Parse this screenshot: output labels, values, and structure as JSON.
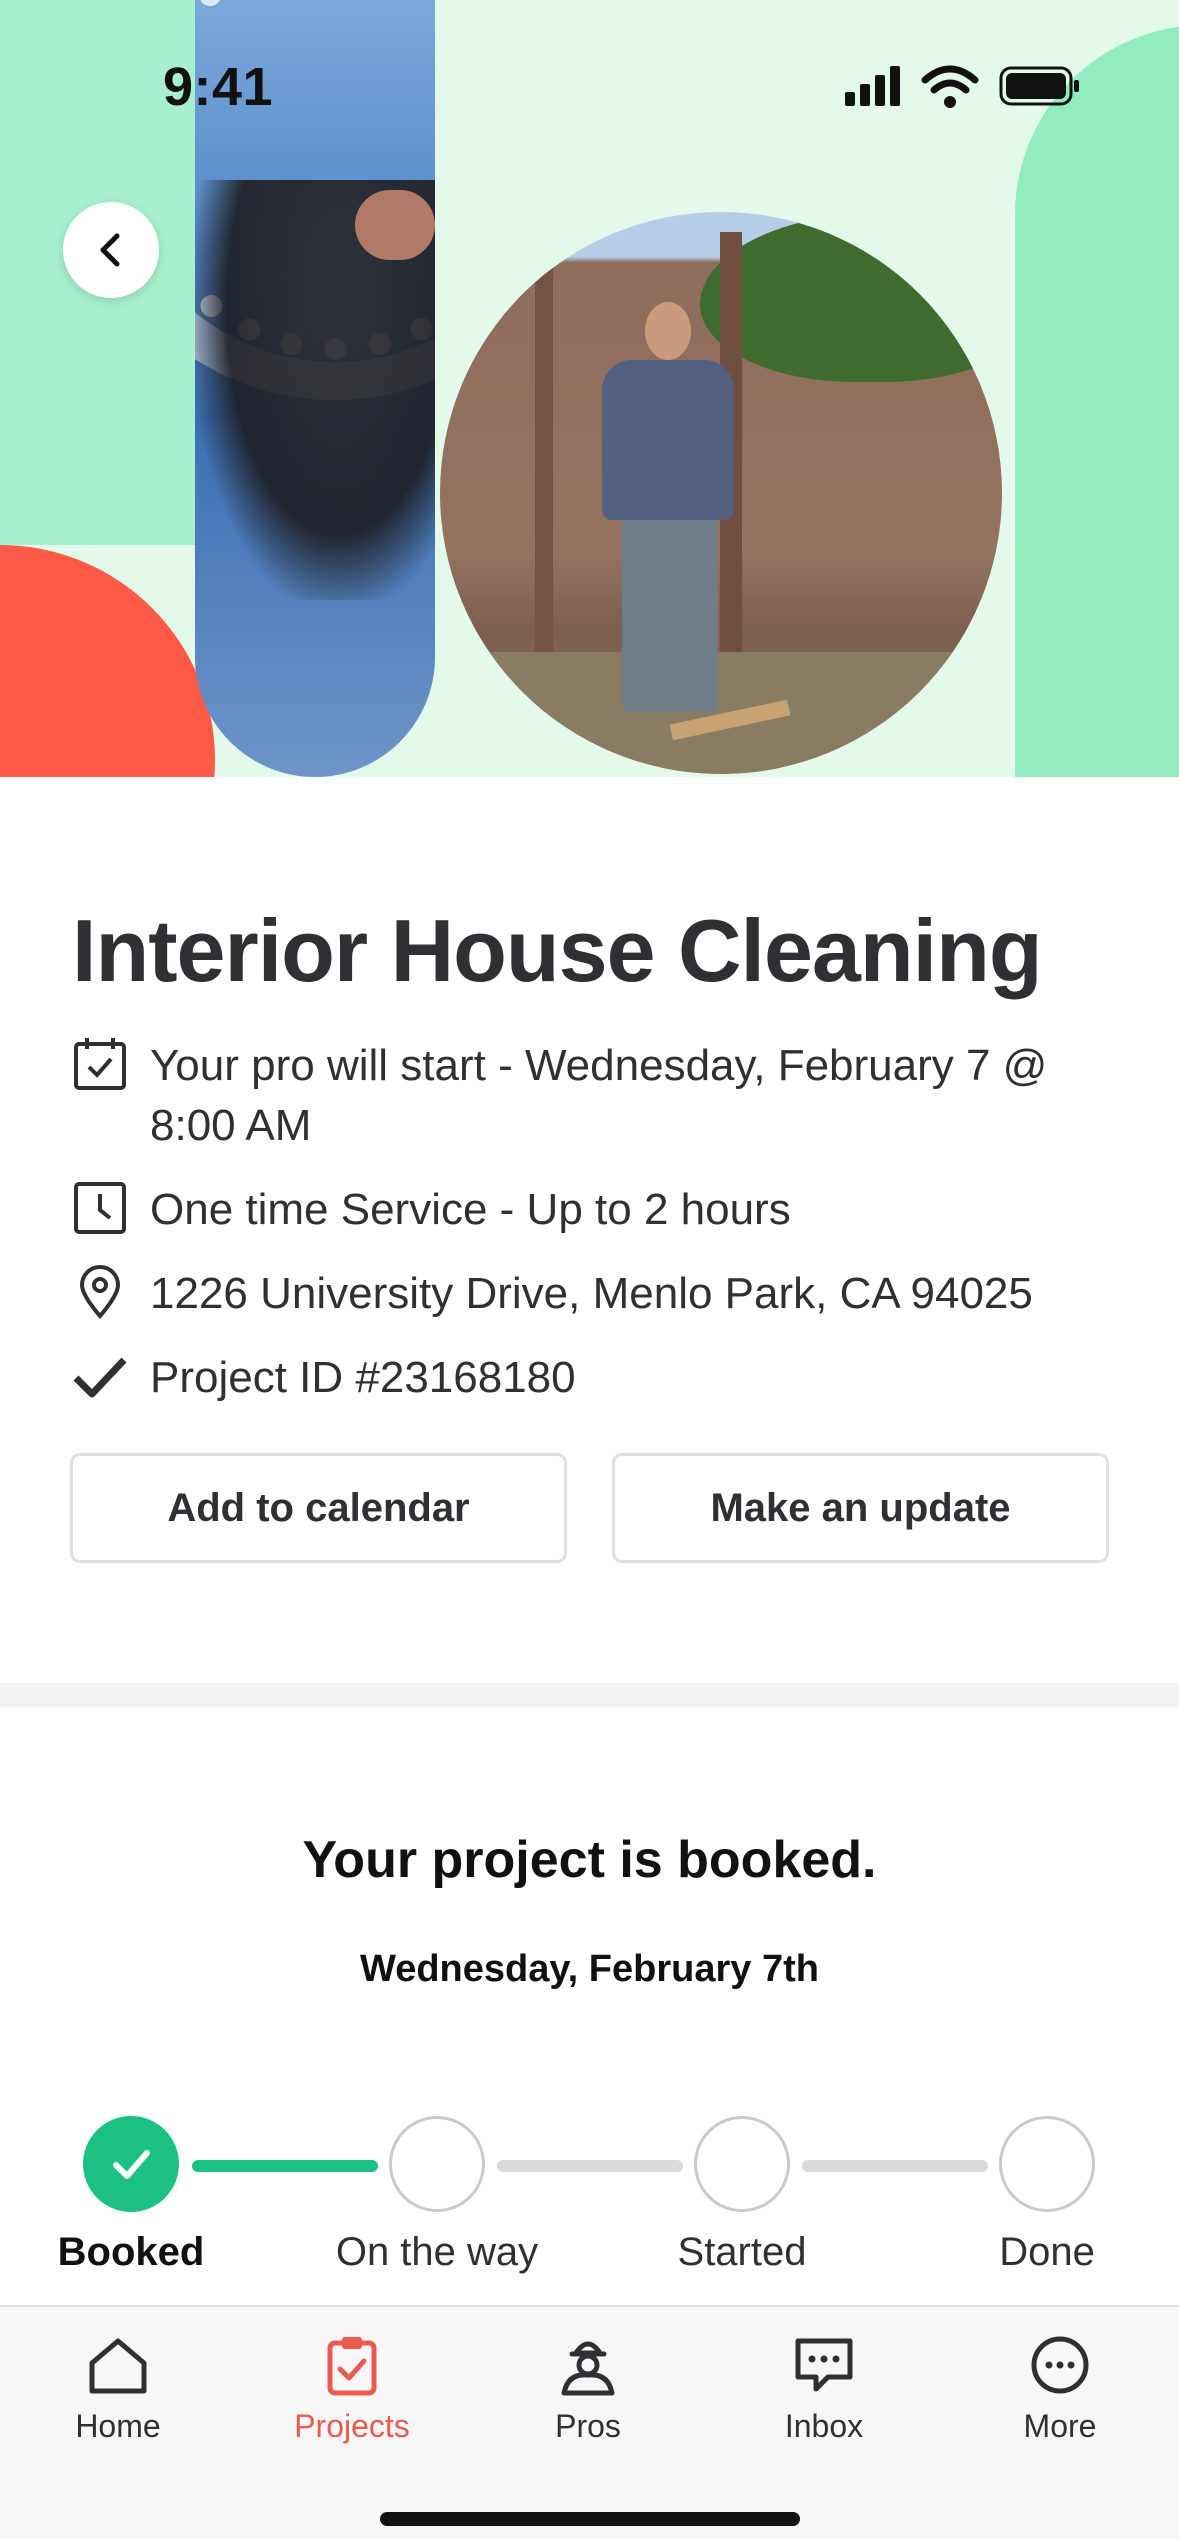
{
  "status_bar": {
    "time": "9:41",
    "icons": [
      "signal-icon",
      "wifi-icon",
      "battery-icon"
    ]
  },
  "hero": {
    "back_icon": "chevron-left-icon"
  },
  "project": {
    "title": "Interior House Cleaning",
    "details": [
      {
        "icon": "calendar-check-icon",
        "text": "Your pro will start - Wednesday, February 7 @ 8:00 AM"
      },
      {
        "icon": "clock-icon",
        "text": "One time Service - Up to 2 hours"
      },
      {
        "icon": "map-pin-icon",
        "text": "1226 University Drive, Menlo Park, CA 94025"
      },
      {
        "icon": "checkmark-icon",
        "text": "Project ID #23168180"
      }
    ],
    "actions": {
      "add_to_calendar": "Add to calendar",
      "make_update": "Make an update"
    }
  },
  "booking": {
    "headline": "Your project is booked.",
    "date": "Wednesday, February 7th",
    "steps": [
      {
        "label": "Booked",
        "complete": true
      },
      {
        "label": "On the way",
        "complete": false
      },
      {
        "label": "Started",
        "complete": false
      },
      {
        "label": "Done",
        "complete": false
      }
    ]
  },
  "tab_bar": {
    "items": [
      {
        "label": "Home",
        "icon": "home-icon",
        "active": false
      },
      {
        "label": "Projects",
        "icon": "clipboard-check-icon",
        "active": true
      },
      {
        "label": "Pros",
        "icon": "pro-person-icon",
        "active": false
      },
      {
        "label": "Inbox",
        "icon": "chat-bubble-icon",
        "active": false
      },
      {
        "label": "More",
        "icon": "more-dots-icon",
        "active": false
      }
    ]
  },
  "colors": {
    "accent_green": "#1cc082",
    "active_tab": "#ea5b4d",
    "hero_bg": "#e3faeb",
    "hero_red": "#ff5a47"
  }
}
